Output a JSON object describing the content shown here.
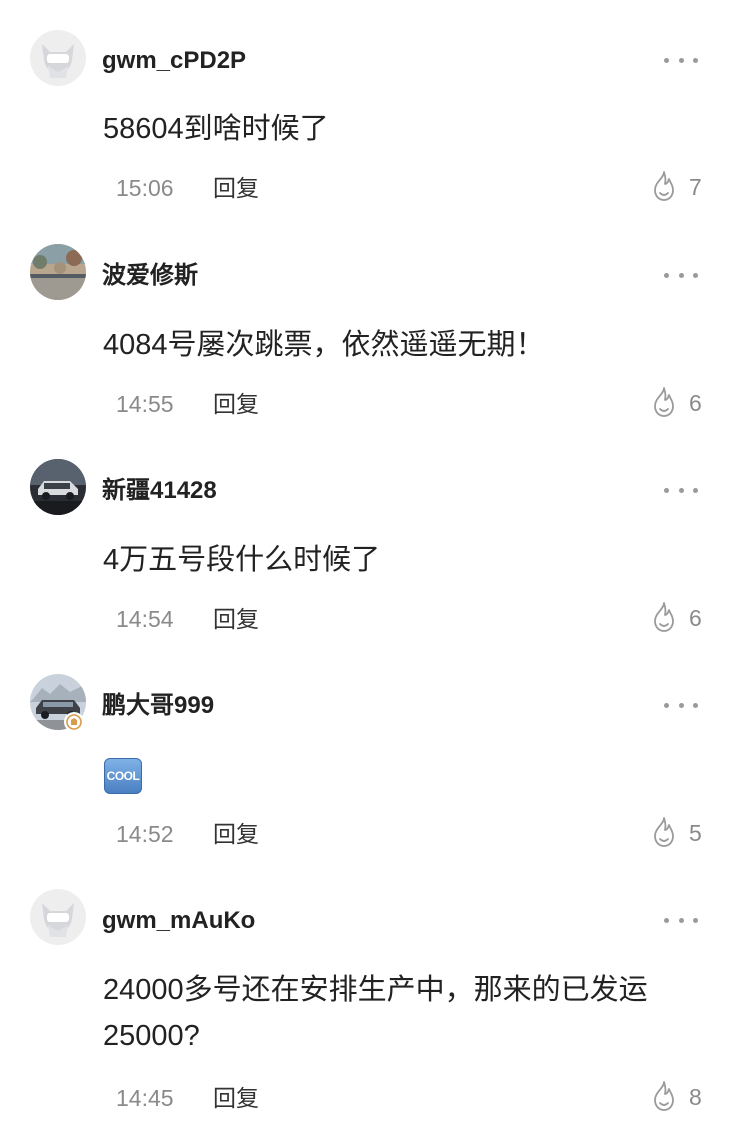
{
  "comments": [
    {
      "username": "gwm_cPD2P",
      "text": "58604到啥时候了",
      "time": "15:06",
      "reply_label": "回复",
      "likes": "7",
      "avatar": "robot-avatar-icon"
    },
    {
      "username": "波爱修斯",
      "text": "4084号屡次跳票，依然遥遥无期！",
      "time": "14:55",
      "reply_label": "回复",
      "likes": "6",
      "avatar": "photo-avatar"
    },
    {
      "username": "新疆41428",
      "text": "4万五号段什么时候了",
      "time": "14:54",
      "reply_label": "回复",
      "likes": "6",
      "avatar": "car-photo-avatar"
    },
    {
      "username": "鹏大哥999",
      "text": "",
      "emoji": "COOL",
      "time": "14:52",
      "reply_label": "回复",
      "likes": "5",
      "avatar": "car-photo-avatar"
    },
    {
      "username": "gwm_mAuKo",
      "text": "24000多号还在安排生产中，那来的已发运25000?",
      "time": "14:45",
      "reply_label": "回复",
      "likes": "8",
      "avatar": "robot-avatar-icon"
    }
  ],
  "colors": {
    "username": "#222222",
    "meta": "#8a8a8a",
    "reply": "#333333"
  }
}
